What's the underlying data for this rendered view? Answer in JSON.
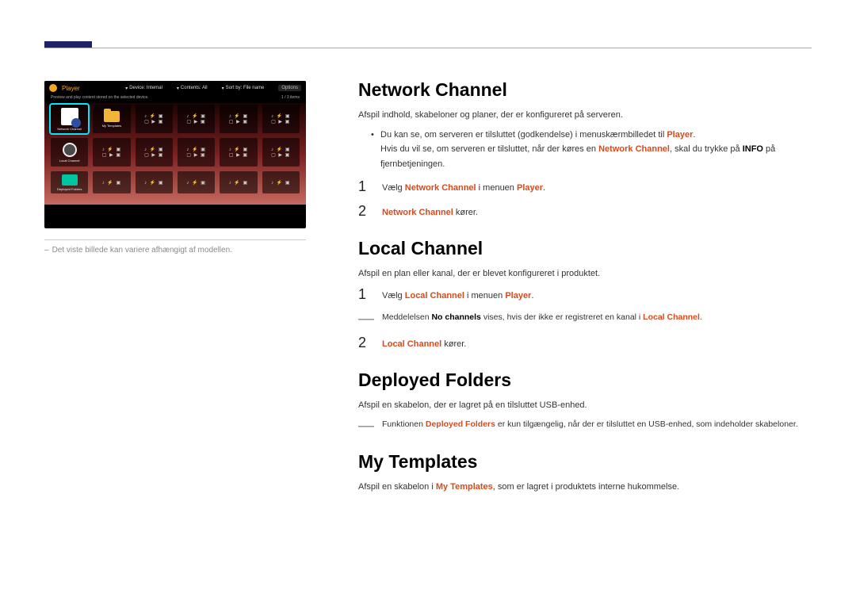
{
  "screenshot": {
    "player_title": "Player",
    "device_label": "Device: Internal",
    "contents_label": "Contents: All",
    "sort_label": "Sort by: File name",
    "options_label": "Options",
    "sub_left": "Preview and play content stored on the selected device.",
    "count": "1 / 3 items",
    "tiles": {
      "net": "Network Channel",
      "tpl": "My Templates",
      "local": "Local Channel",
      "dep": "Deployed Folders"
    }
  },
  "caption": "Det viste billede kan variere afhængigt af modellen.",
  "network": {
    "heading": "Network Channel",
    "desc": "Afspil indhold, skabeloner og planer, der er konfigureret på serveren.",
    "bullet_pre": "Du kan se, om serveren er tilsluttet (godkendelse) i menuskærmbilledet til ",
    "bullet_player": "Player",
    "bullet_post": ".",
    "bullet_line2a": "Hvis du vil se, om serveren er tilsluttet, når der køres en ",
    "bullet_nc": "Network Channel",
    "bullet_line2b": ", skal du trykke på ",
    "bullet_info": "INFO",
    "bullet_line2c": " på fjernbetjeningen.",
    "step1_a": "Vælg ",
    "step1_b": "Network Channel",
    "step1_c": " i menuen ",
    "step1_d": "Player",
    "step1_e": ".",
    "step2_a": "Network Channel",
    "step2_b": " kører."
  },
  "local": {
    "heading": "Local Channel",
    "desc": "Afspil en plan eller kanal, der er blevet konfigureret i produktet.",
    "step1_a": "Vælg ",
    "step1_b": "Local Channel",
    "step1_c": " i menuen ",
    "step1_d": "Player",
    "step1_e": ".",
    "sub_a": "Meddelelsen ",
    "sub_b": "No channels",
    "sub_c": " vises, hvis der ikke er registreret en kanal i ",
    "sub_d": "Local Channel",
    "sub_e": ".",
    "step2_a": "Local Channel",
    "step2_b": " kører."
  },
  "deployed": {
    "heading": "Deployed Folders",
    "desc": "Afspil en skabelon, der er lagret på en tilsluttet USB-enhed.",
    "sub_a": "Funktionen ",
    "sub_b": "Deployed Folders",
    "sub_c": " er kun tilgængelig, når der er tilsluttet en USB-enhed, som indeholder skabeloner."
  },
  "templates": {
    "heading": "My Templates",
    "desc_a": "Afspil en skabelon i ",
    "desc_b": "My Templates",
    "desc_c": ", som er lagret i produktets interne hukommelse."
  }
}
